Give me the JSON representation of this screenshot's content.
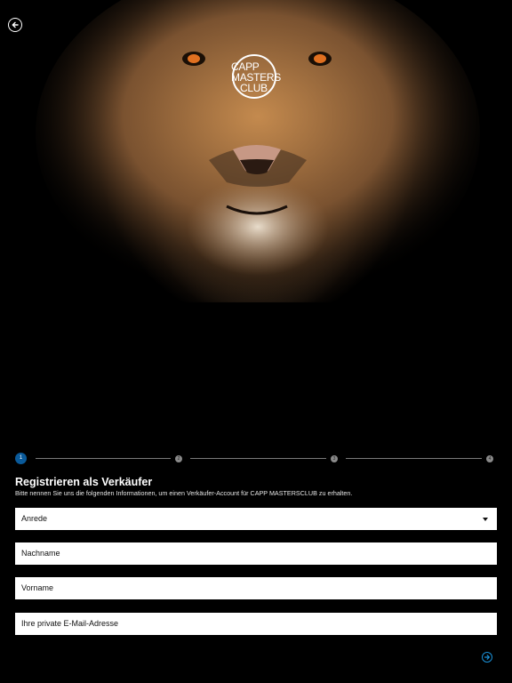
{
  "header": {
    "back_icon": "arrow-left-circle-icon",
    "logo": {
      "line1": "CAPP",
      "line2": "MASTERS",
      "line3": "CLUB"
    }
  },
  "stepper": {
    "steps": [
      {
        "label": "1",
        "state": "active"
      },
      {
        "label": "2",
        "state": "inactive"
      },
      {
        "label": "3",
        "state": "inactive"
      },
      {
        "label": "4",
        "state": "inactive"
      }
    ],
    "active_color": "#0a5a9a"
  },
  "form": {
    "title": "Registrieren als Verkäufer",
    "subtitle": "Bitte nennen Sie uns die folgenden Informationen, um einen Verkäufer-Account für CAPP MASTERSCLUB zu erhalten.",
    "salutation_label": "Anrede",
    "lastname_label": "Nachname",
    "firstname_label": "Vorname",
    "email_label": "Ihre private E-Mail-Adresse"
  },
  "footer": {
    "next_icon": "arrow-right-circle-icon",
    "accent_color": "#1a8fd6"
  }
}
